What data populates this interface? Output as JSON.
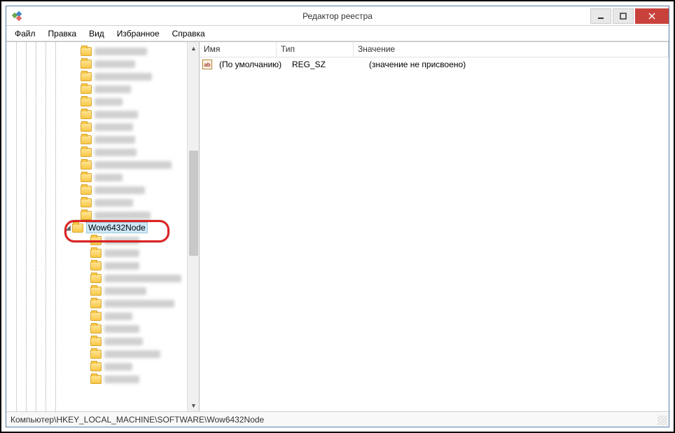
{
  "window": {
    "title": "Редактор реестра"
  },
  "menu": {
    "file": "Файл",
    "edit": "Правка",
    "view": "Вид",
    "favorites": "Избранное",
    "help": "Справка"
  },
  "tree": {
    "selected_key": "Wow6432Node"
  },
  "list": {
    "columns": {
      "name": "Имя",
      "type": "Тип",
      "value": "Значение"
    },
    "rows": [
      {
        "name": "(По умолчанию)",
        "type": "REG_SZ",
        "value": "(значение не присвоено)"
      }
    ]
  },
  "status": {
    "path": "Компьютер\\HKEY_LOCAL_MACHINE\\SOFTWARE\\Wow6432Node"
  }
}
